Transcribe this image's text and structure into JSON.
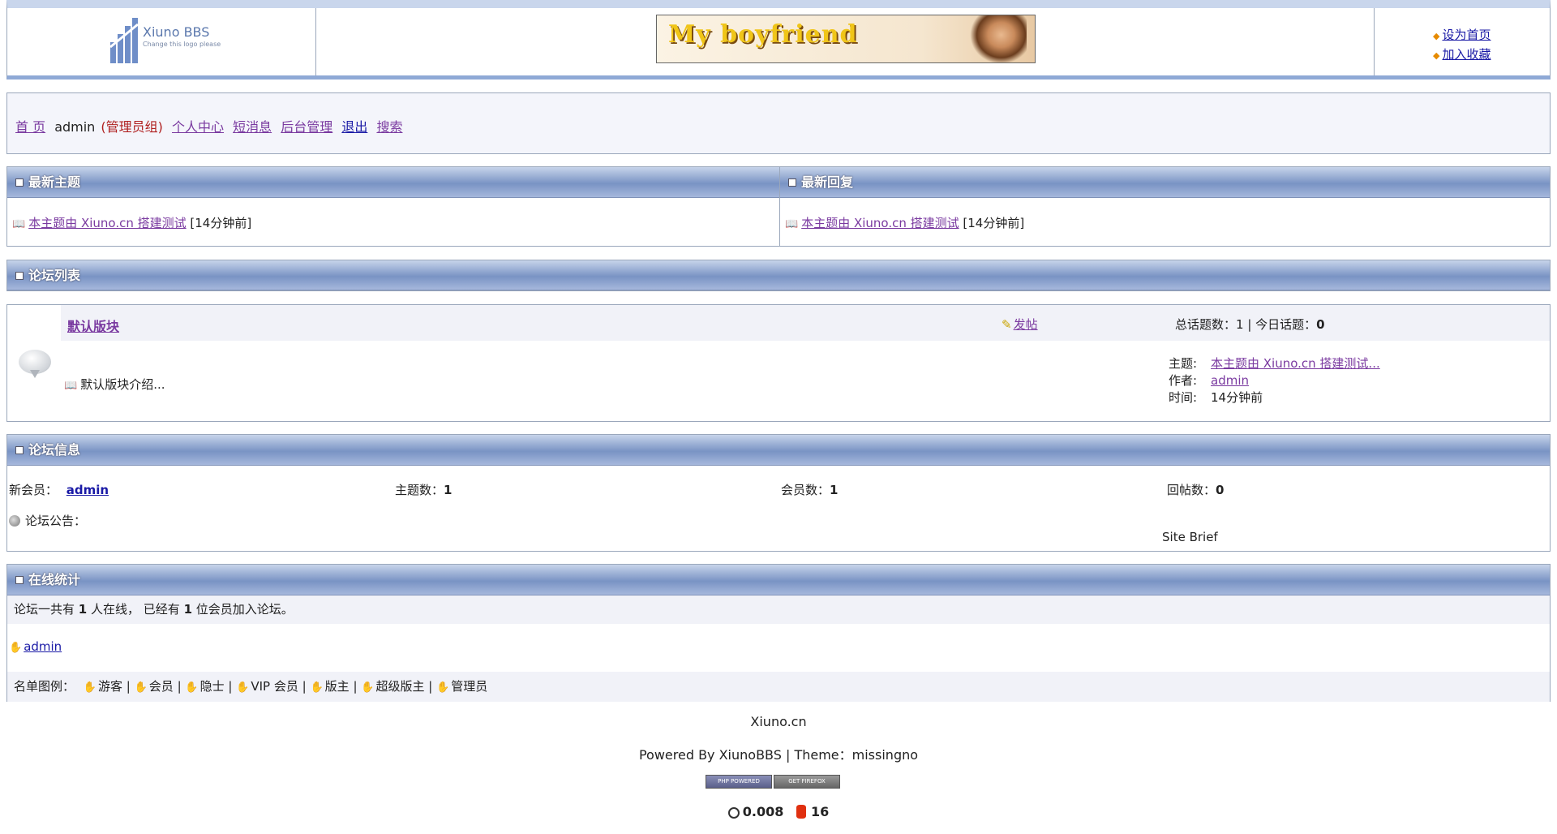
{
  "header": {
    "logo_title": "Xiuno BBS",
    "logo_subtitle": "Change this logo please",
    "banner_text": "My boyfriend",
    "set_homepage": "设为首页",
    "add_favorite": "加入收藏"
  },
  "nav": {
    "home": "首 页",
    "username": "admin",
    "group": "(管理员组)",
    "user_center": "个人中心",
    "messages": "短消息",
    "admin_panel": "后台管理",
    "logout": "退出",
    "search": "搜索"
  },
  "latest": {
    "topics_title": "最新主题",
    "replies_title": "最新回复",
    "topic_link": "本主题由 Xiuno.cn 搭建测试",
    "topic_time": "[14分钟前]",
    "reply_link": "本主题由 Xiuno.cn 搭建测试",
    "reply_time": "[14分钟前]"
  },
  "forum_list": {
    "title": "论坛列表",
    "forum": {
      "name": "默认版块",
      "post_label": "发帖",
      "stats_prefix": "总话题数：",
      "total_topics": "1",
      "stats_sep": "| 今日话题：",
      "today_topics": "0",
      "description": "默认版块介绍...",
      "last_topic_label": "主题:",
      "last_topic": "本主题由 Xiuno.cn 搭建测试...",
      "author_label": "作者:",
      "author": "admin",
      "time_label": "时间:",
      "time": "14分钟前"
    }
  },
  "forum_info": {
    "title": "论坛信息",
    "new_member_label": "新会员：",
    "new_member": "admin",
    "topics_label": "主题数：",
    "topics": "1",
    "members_label": "会员数：",
    "members": "1",
    "posts_label": "回帖数：",
    "posts": "0",
    "notice_label": "论坛公告：",
    "site_brief": "Site Brief"
  },
  "online": {
    "title": "在线统计",
    "line_a": "论坛一共有",
    "online_count": "1",
    "line_b": "人在线，  已经有",
    "member_count": "1",
    "line_c": "位会员加入论坛。",
    "online_user": "admin",
    "legend_label": "名单图例：",
    "legend": [
      "游客",
      "会员",
      "隐士",
      "VIP 会员",
      "版主",
      "超级版主",
      "管理员"
    ]
  },
  "footer": {
    "site": "Xiuno.cn",
    "powered": "Powered By XiunoBBS | Theme：missingno",
    "badge_php": "PHP POWERED",
    "badge_ff": "GET FIREFOX",
    "exec_time": "0.008",
    "queries": "16"
  }
}
